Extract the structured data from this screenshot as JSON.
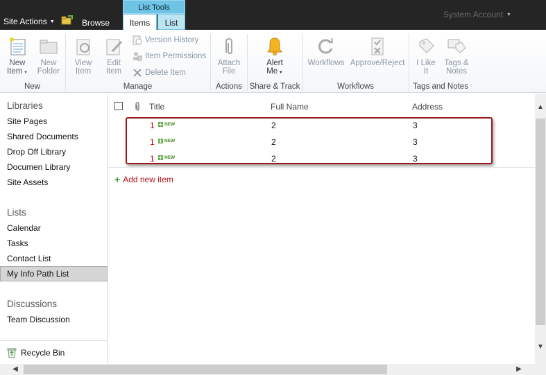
{
  "topbar": {
    "site_actions": "Site Actions",
    "browse": "Browse",
    "list_tools": "List Tools",
    "tab_items": "Items",
    "tab_list": "List",
    "user": "System Account"
  },
  "ribbon": {
    "new_item": [
      "New",
      "Item"
    ],
    "new_folder": [
      "New",
      "Folder"
    ],
    "view_item": [
      "View",
      "Item"
    ],
    "edit_item": [
      "Edit",
      "Item"
    ],
    "version_history": "Version History",
    "item_permissions": "Item Permissions",
    "delete_item": "Delete Item",
    "attach_file": [
      "Attach",
      "File"
    ],
    "alert_me": [
      "Alert",
      "Me"
    ],
    "workflows": "Workflows",
    "approve_reject": "Approve/Reject",
    "i_like_it": [
      "I Like",
      "It"
    ],
    "tags_notes": [
      "Tags &",
      "Notes"
    ],
    "groups": {
      "new": "New",
      "manage": "Manage",
      "actions": "Actions",
      "share_track": "Share & Track",
      "workflows": "Workflows",
      "tags_notes": "Tags and Notes"
    }
  },
  "sidebar": {
    "libraries_heading": "Libraries",
    "libraries": [
      "Site Pages",
      "Shared Documents",
      "Drop Off Library",
      "Documen Library",
      "Site Assets"
    ],
    "lists_heading": "Lists",
    "lists": [
      "Calendar",
      "Tasks",
      "Contact List",
      "My Info Path List"
    ],
    "selected_list": "My Info Path List",
    "discussions_heading": "Discussions",
    "discussions": [
      "Team Discussion"
    ],
    "recycle_bin": "Recycle Bin"
  },
  "list": {
    "columns": [
      "Title",
      "Full Name",
      "Address"
    ],
    "new_badge": "NEW",
    "rows": [
      {
        "title": "1",
        "full_name": "2",
        "address": "3"
      },
      {
        "title": "1",
        "full_name": "2",
        "address": "3"
      },
      {
        "title": "1",
        "full_name": "2",
        "address": "3"
      }
    ],
    "add_new_item": "Add new item"
  },
  "colors": {
    "topbar_bg": "#252525",
    "list_tools_accent": "#6fc3e5",
    "title_link": "#cc0000",
    "annotation_box": "#9a1a1a",
    "new_badge": "#3a8a1a"
  }
}
